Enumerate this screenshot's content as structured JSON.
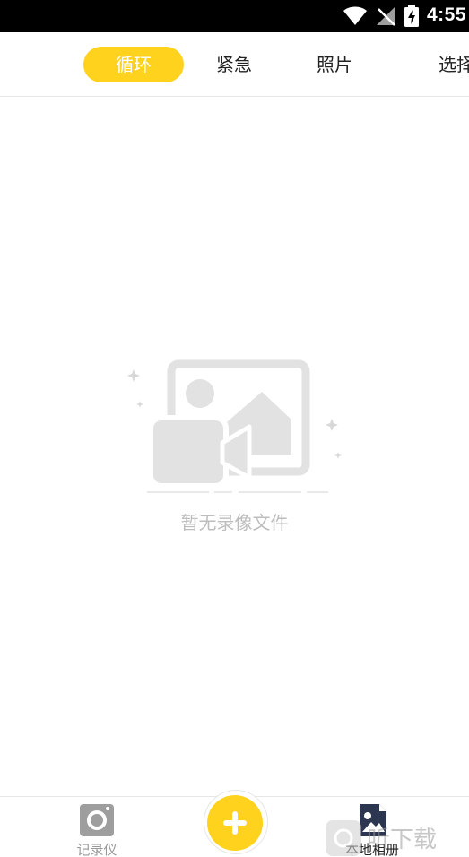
{
  "status_bar": {
    "time": "4:55",
    "icons": [
      "wifi-icon",
      "no-signal-icon",
      "battery-charging-icon"
    ]
  },
  "tabs": [
    {
      "label": "循环",
      "active": true
    },
    {
      "label": "紧急",
      "active": false
    },
    {
      "label": "照片",
      "active": false
    },
    {
      "label": "选择",
      "active": false
    }
  ],
  "empty_state": {
    "icon": "video-image-placeholder-icon",
    "message": "暂无录像文件"
  },
  "bottom_nav": {
    "recorder": {
      "label": "记录仪",
      "icon": "camera-icon"
    },
    "add": {
      "icon": "plus-icon"
    },
    "album": {
      "label": "本地相册",
      "icon": "album-icon"
    }
  },
  "watermark": {
    "text": "听下载"
  },
  "colors": {
    "accent": "#ffd21e",
    "status_bar": "#000000",
    "empty_gray": "#e2e2e2",
    "text_gray": "#bdbdbd"
  }
}
